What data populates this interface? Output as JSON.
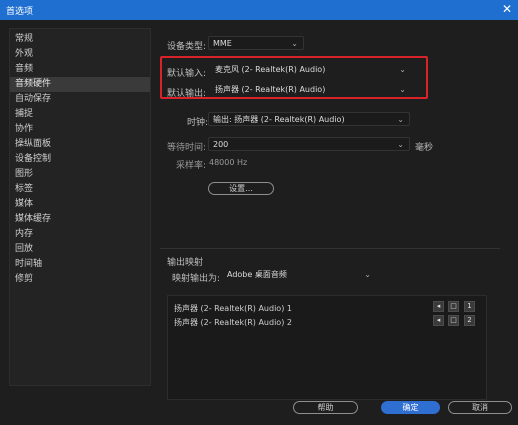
{
  "window": {
    "title": "首选项",
    "close_glyph": "✕"
  },
  "sidebar": {
    "items": [
      {
        "label": "常规",
        "selected": false
      },
      {
        "label": "外观",
        "selected": false
      },
      {
        "label": "音频",
        "selected": false
      },
      {
        "label": "音频硬件",
        "selected": true
      },
      {
        "label": "自动保存",
        "selected": false
      },
      {
        "label": "捕捉",
        "selected": false
      },
      {
        "label": "协作",
        "selected": false
      },
      {
        "label": "操纵面板",
        "selected": false
      },
      {
        "label": "设备控制",
        "selected": false
      },
      {
        "label": "图形",
        "selected": false
      },
      {
        "label": "标签",
        "selected": false
      },
      {
        "label": "媒体",
        "selected": false
      },
      {
        "label": "媒体缓存",
        "selected": false
      },
      {
        "label": "内存",
        "selected": false
      },
      {
        "label": "回放",
        "selected": false
      },
      {
        "label": "时间轴",
        "selected": false
      },
      {
        "label": "修剪",
        "selected": false
      }
    ]
  },
  "audio_hardware": {
    "device_class_label": "设备类型:",
    "device_class_value": "MME",
    "default_input_label": "默认输入:",
    "default_input_value": "麦克风 (2- Realtek(R) Audio)",
    "default_output_label": "默认输出:",
    "default_output_value": "扬声器 (2- Realtek(R) Audio)",
    "clock_label": "时钟:",
    "clock_value": "输出: 扬声器 (2- Realtek(R) Audio)",
    "latency_label": "等待时间:",
    "latency_value": "200",
    "latency_unit": "毫秒",
    "sample_rate_label": "采样率:",
    "sample_rate_value": "48000 Hz",
    "settings_button": "设置..."
  },
  "output_mapping": {
    "section_title": "输出映射",
    "map_for_label": "映射输出为:",
    "map_for_value": "Adobe 桌面音频",
    "rows": [
      {
        "label": "扬声器 (2- Realtek(R) Audio) 1",
        "channel": "1"
      },
      {
        "label": "扬声器 (2- Realtek(R) Audio) 2",
        "channel": "2"
      }
    ]
  },
  "footer": {
    "help": "帮助",
    "ok": "确定",
    "cancel": "取消"
  },
  "icons": {
    "dropdown": "chevron-down-icon",
    "speaker": "speaker-icon",
    "marker": "marker-icon"
  }
}
